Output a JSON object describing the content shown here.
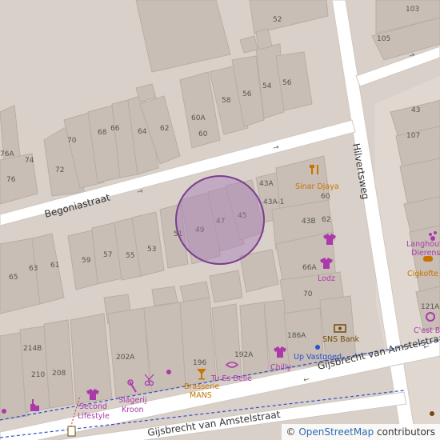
{
  "map": {
    "streets": {
      "begonia": "Begoniastraat",
      "hilvert": "Hilvertsweg",
      "gijs1": "Gijsbrecht van Amstelstraat",
      "gijs2": "Gijsbrecht van Amstelstraat"
    },
    "house_numbers": [
      "103",
      "52",
      "105",
      "58",
      "56",
      "54",
      "56",
      "43",
      "60A",
      "68",
      "66",
      "64",
      "62",
      "70",
      "60",
      "76A",
      "74",
      "72",
      "76",
      "107",
      "43A",
      "60",
      "43A-1",
      "43B",
      "62",
      "51",
      "49",
      "47",
      "45",
      "59",
      "57",
      "55",
      "53",
      "63",
      "61",
      "65",
      "66A",
      "70",
      "121A",
      "214B",
      "202A",
      "186A",
      "196",
      "192A",
      "210",
      "208"
    ],
    "pois": {
      "sinar": "Sinar Djaya",
      "lodz": "Lodz",
      "langhout": "Langhout",
      "dieren": "Dierenspeciaa",
      "cigkofte": "Cigkofte",
      "cestbon": "C'est Bon",
      "sns": "SNS Bank",
      "upvast": "Up Vastgoed",
      "chilly": "Chilly",
      "tuesbelle": "Tu Es Belle",
      "brasserie": "Brasserie",
      "mans": "MANS",
      "slagerij": "Slagerij",
      "kroon": "Kroon",
      "second": "Second",
      "lifestyle": "Lifestyle"
    },
    "attribution": {
      "prefix": "©",
      "link": "OpenStreetMap",
      "suffix": " contributors"
    },
    "colors": {
      "background": "#d9d0c9",
      "building": "#c8beb5",
      "building_stroke": "#b8ada3",
      "road": "#ffffff",
      "shop_icon": "#ac39ac",
      "food_icon": "#c77400",
      "bank_icon": "#734a08",
      "marker_fill": "#a77dbb",
      "marker_stroke": "#7a3f8e"
    },
    "icons": [
      "restaurant-icon",
      "clothes-icon",
      "clothes-icon",
      "clothes-icon",
      "pet-icon",
      "bakery-icon",
      "bank-icon",
      "office-icon",
      "beauty-icon",
      "bar-icon",
      "butcher-icon",
      "hairdresser-icon",
      "wine-shop-icon",
      "clothes-icon",
      "parking-icon"
    ]
  }
}
